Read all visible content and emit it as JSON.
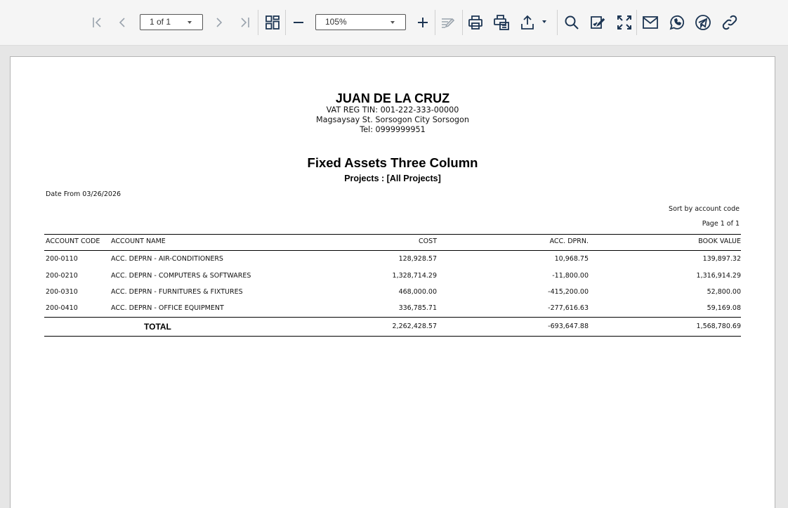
{
  "toolbar": {
    "page_selector": "1 of 1",
    "zoom_selector": "105%"
  },
  "report": {
    "company_name": "JUAN DE LA CRUZ",
    "vat_line": "VAT REG TIN: 001-222-333-00000",
    "address_line": "Magsaysay St. Sorsogon City Sorsogon",
    "tel_line": "Tel: 0999999951",
    "title": "Fixed Assets Three Column",
    "subtitle": "Projects : [All Projects]",
    "date_from": "Date From 03/26/2026",
    "sort_by": "Sort by account code",
    "page_info": "Page 1 of 1",
    "columns": {
      "account_code": "ACCOUNT CODE",
      "account_name": "ACCOUNT NAME",
      "cost": "COST",
      "acc_dprn": "ACC. DPRN.",
      "book_value": "BOOK VALUE"
    },
    "rows": [
      {
        "code": "200-0110",
        "name": "ACC. DEPRN - AIR-CONDITIONERS",
        "cost": "128,928.57",
        "dprn": "10,968.75",
        "book": "139,897.32"
      },
      {
        "code": "200-0210",
        "name": "ACC. DEPRN - COMPUTERS & SOFTWARES",
        "cost": "1,328,714.29",
        "dprn": "-11,800.00",
        "book": "1,316,914.29"
      },
      {
        "code": "200-0310",
        "name": "ACC. DEPRN - FURNITURES & FIXTURES",
        "cost": "468,000.00",
        "dprn": "-415,200.00",
        "book": "52,800.00"
      },
      {
        "code": "200-0410",
        "name": "ACC. DEPRN - OFFICE EQUIPMENT",
        "cost": "336,785.71",
        "dprn": "-277,616.63",
        "book": "59,169.08"
      }
    ],
    "total": {
      "label": "TOTAL",
      "cost": "2,262,428.57",
      "dprn": "-693,647.88",
      "book": "1,568,780.69"
    }
  }
}
